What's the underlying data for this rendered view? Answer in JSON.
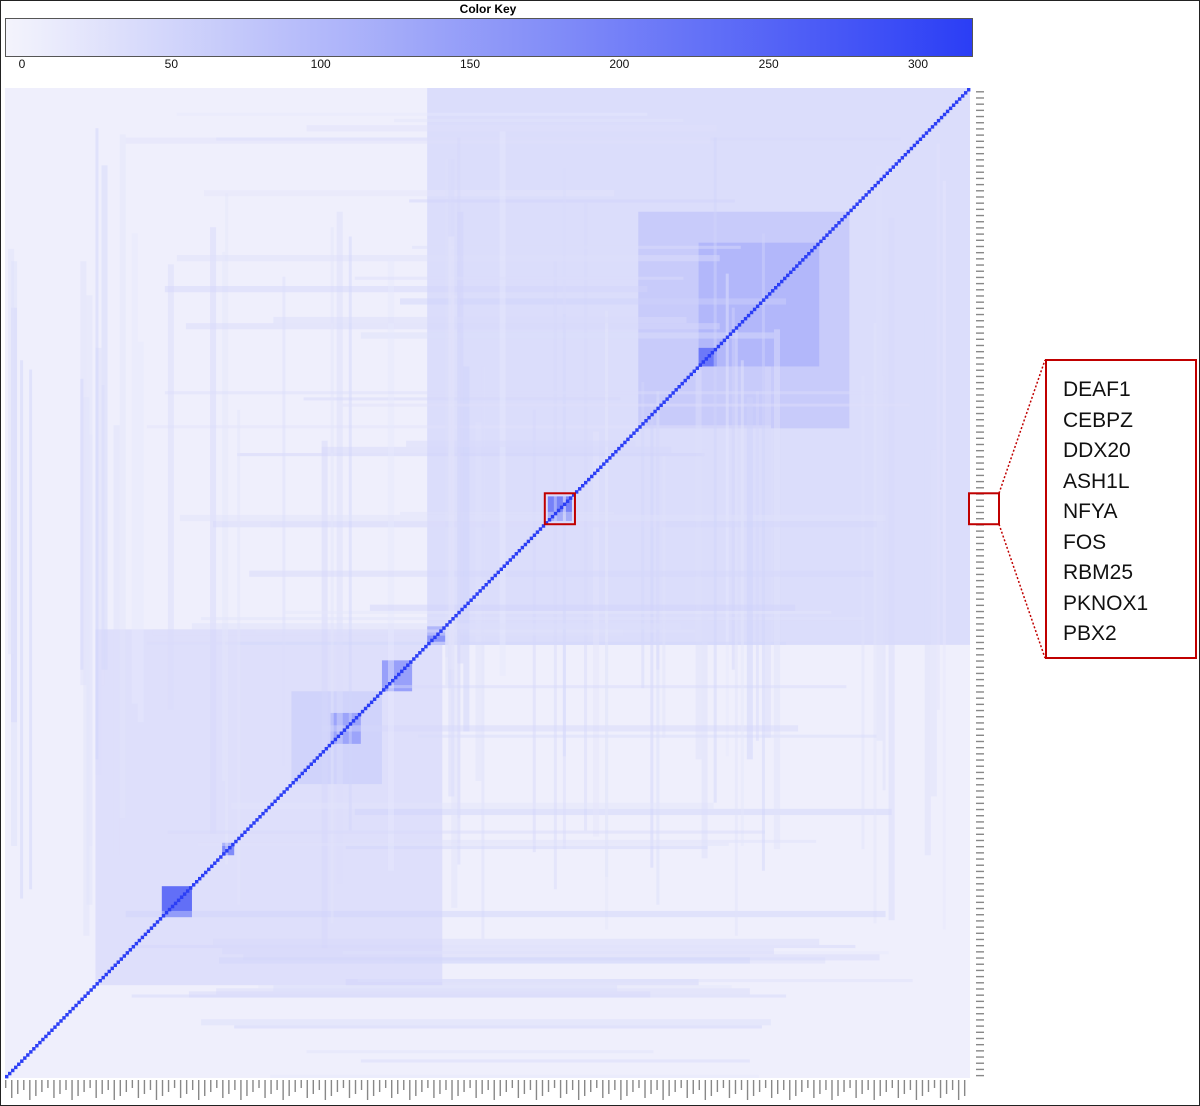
{
  "chart_data": {
    "type": "heatmap",
    "title": "Color Key",
    "color_key": {
      "min": 0,
      "max": 320,
      "ticks": [
        0,
        50,
        100,
        150,
        200,
        250,
        300
      ],
      "low_color": "#f4f4fc",
      "high_color": "#2b3ef5"
    },
    "matrix_size": 320,
    "diagonal_value": 320,
    "background_value": 8,
    "blocks": [
      {
        "rows": [
          140,
          320
        ],
        "cols": [
          140,
          320
        ],
        "value": 45
      },
      {
        "rows": [
          210,
          280
        ],
        "cols": [
          210,
          280
        ],
        "value": 75
      },
      {
        "rows": [
          230,
          270
        ],
        "cols": [
          230,
          270
        ],
        "value": 110
      },
      {
        "rows": [
          30,
          145
        ],
        "cols": [
          30,
          145
        ],
        "value": 40
      },
      {
        "rows": [
          95,
          125
        ],
        "cols": [
          95,
          125
        ],
        "value": 60
      },
      {
        "rows": [
          180,
          188
        ],
        "cols": [
          180,
          188
        ],
        "value": 220
      },
      {
        "rows": [
          52,
          62
        ],
        "cols": [
          52,
          62
        ],
        "value": 255
      },
      {
        "rows": [
          72,
          76
        ],
        "cols": [
          72,
          76
        ],
        "value": 200
      },
      {
        "rows": [
          230,
          236
        ],
        "cols": [
          230,
          236
        ],
        "value": 230
      },
      {
        "rows": [
          140,
          146
        ],
        "cols": [
          140,
          146
        ],
        "value": 180
      },
      {
        "rows": [
          125,
          135
        ],
        "cols": [
          125,
          135
        ],
        "value": 160
      },
      {
        "rows": [
          108,
          118
        ],
        "cols": [
          108,
          118
        ],
        "value": 150
      }
    ],
    "highlight": {
      "rows": [
        179,
        189
      ],
      "cols": [
        179,
        189
      ],
      "color": "#c00000"
    },
    "highlighted_labels": [
      "DEAF1",
      "CEBPZ",
      "DDX20",
      "ASH1L",
      "NFYA",
      "FOS",
      "RBM25",
      "PKNOX1",
      "PBX2"
    ]
  }
}
